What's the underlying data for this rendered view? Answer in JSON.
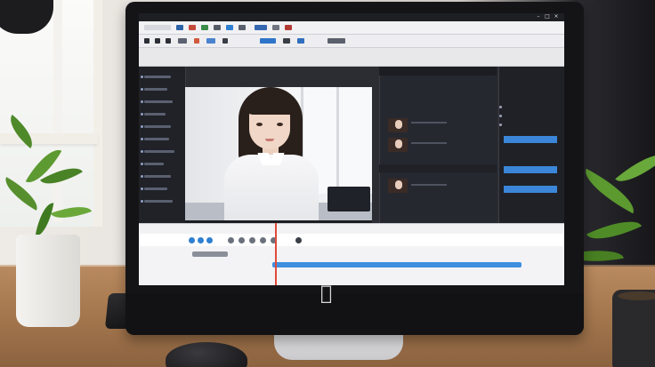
{
  "scene": {
    "description_colors": {
      "accent_blue": "#3b86d8",
      "timeline_clip": "#3f8ee0",
      "playhead": "#e04b3b",
      "ui_dark": "#202227"
    },
    "logo_icon": "apple-logo-icon"
  },
  "app": {
    "menu": [
      " ",
      " ",
      " ",
      " "
    ],
    "window_controls": [
      "–",
      "□",
      "×"
    ]
  },
  "timeline": {
    "playhead_fraction": 0.32
  }
}
